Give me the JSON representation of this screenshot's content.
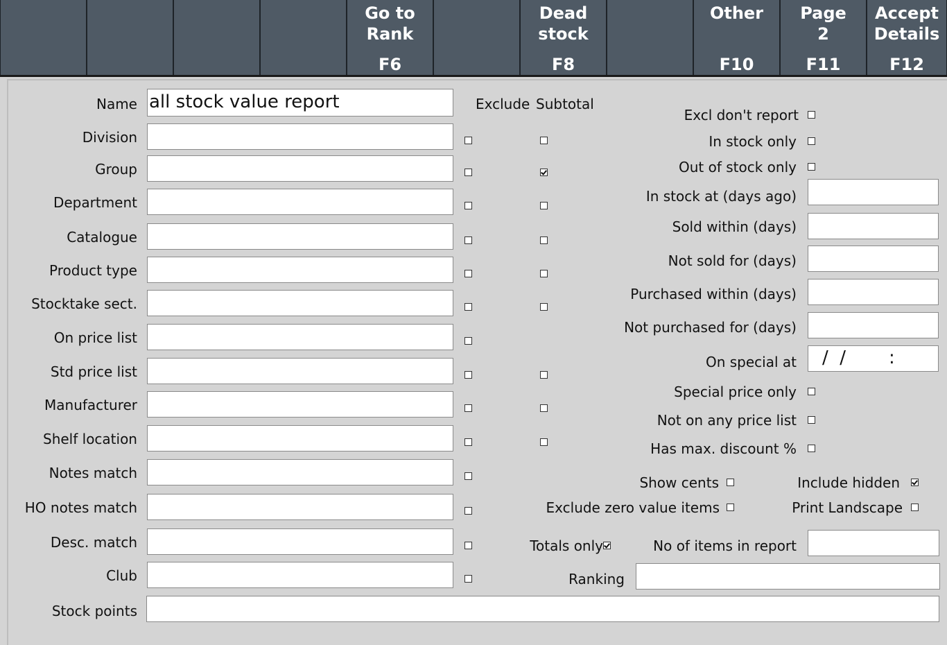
{
  "toolbar": {
    "buttons": [
      {
        "line1": "",
        "line2": ""
      },
      {
        "line1": "",
        "line2": ""
      },
      {
        "line1": "",
        "line2": ""
      },
      {
        "line1": "",
        "line2": ""
      },
      {
        "line1": "Go to\nRank",
        "line2": "F6"
      },
      {
        "line1": "",
        "line2": ""
      },
      {
        "line1": "Dead\nstock",
        "line2": "F8"
      },
      {
        "line1": "",
        "line2": ""
      },
      {
        "line1": "Other",
        "line2": "F10"
      },
      {
        "line1": "Page\n2",
        "line2": "F11"
      },
      {
        "line1": "Accept\nDetails",
        "line2": "F12"
      }
    ]
  },
  "form": {
    "name_label": "Name",
    "name_value": "all stock value report",
    "exclude_header": "Exclude",
    "subtotal_header": "Subtotal",
    "fields": [
      {
        "label": "Division",
        "value": "",
        "exclude": false,
        "subtotal": false
      },
      {
        "label": "Group",
        "value": "",
        "exclude": false,
        "subtotal": true
      },
      {
        "label": "Department",
        "value": "",
        "exclude": false,
        "subtotal": false
      },
      {
        "label": "Catalogue",
        "value": "",
        "exclude": false,
        "subtotal": false
      },
      {
        "label": "Product type",
        "value": "",
        "exclude": false,
        "subtotal": false
      },
      {
        "label": "Stocktake sect.",
        "value": "",
        "exclude": false,
        "subtotal": false
      },
      {
        "label": "On price list",
        "value": "",
        "exclude": false,
        "subtotal": null
      },
      {
        "label": "Std price list",
        "value": "",
        "exclude": false,
        "subtotal": false
      },
      {
        "label": "Manufacturer",
        "value": "",
        "exclude": false,
        "subtotal": false
      },
      {
        "label": "Shelf location",
        "value": "",
        "exclude": false,
        "subtotal": false
      },
      {
        "label": "Notes match",
        "value": "",
        "exclude": false,
        "subtotal": null
      },
      {
        "label": "HO notes match",
        "value": "",
        "exclude": false,
        "subtotal": null
      },
      {
        "label": "Desc. match",
        "value": "",
        "exclude": false,
        "subtotal": null
      },
      {
        "label": "Club",
        "value": "",
        "exclude": false,
        "subtotal": null
      }
    ],
    "stock_points_label": "Stock points",
    "stock_points_value": ""
  },
  "right": {
    "excl_dont_report": {
      "label": "Excl don't report",
      "checked": false
    },
    "in_stock_only": {
      "label": "In stock only",
      "checked": false
    },
    "out_of_stock_only": {
      "label": "Out of stock only",
      "checked": false
    },
    "in_stock_at_days_ago": {
      "label": "In stock at (days ago)",
      "value": ""
    },
    "sold_within_days": {
      "label": "Sold within (days)",
      "value": ""
    },
    "not_sold_for_days": {
      "label": "Not sold for (days)",
      "value": ""
    },
    "purchased_within_days": {
      "label": "Purchased within (days)",
      "value": ""
    },
    "not_purchased_for_days": {
      "label": "Not purchased for (days)",
      "value": ""
    },
    "on_special_at": {
      "label": "On special at",
      "date_sep": "/  /",
      "time_sep": ":"
    },
    "special_price_only": {
      "label": "Special price only",
      "checked": false
    },
    "not_on_any_price_list": {
      "label": "Not on any price list",
      "checked": false
    },
    "has_max_discount": {
      "label": "Has max. discount %",
      "checked": false
    },
    "show_cents": {
      "label": "Show cents",
      "checked": false
    },
    "include_hidden": {
      "label": "Include hidden",
      "checked": true
    },
    "exclude_zero_value_items": {
      "label": "Exclude zero value items",
      "checked": false
    },
    "print_landscape": {
      "label": "Print Landscape",
      "checked": false
    },
    "totals_only": {
      "label": "Totals only",
      "checked": true
    },
    "no_of_items_in_report": {
      "label": "No of items in report",
      "value": ""
    },
    "ranking": {
      "label": "Ranking",
      "value": ""
    }
  }
}
